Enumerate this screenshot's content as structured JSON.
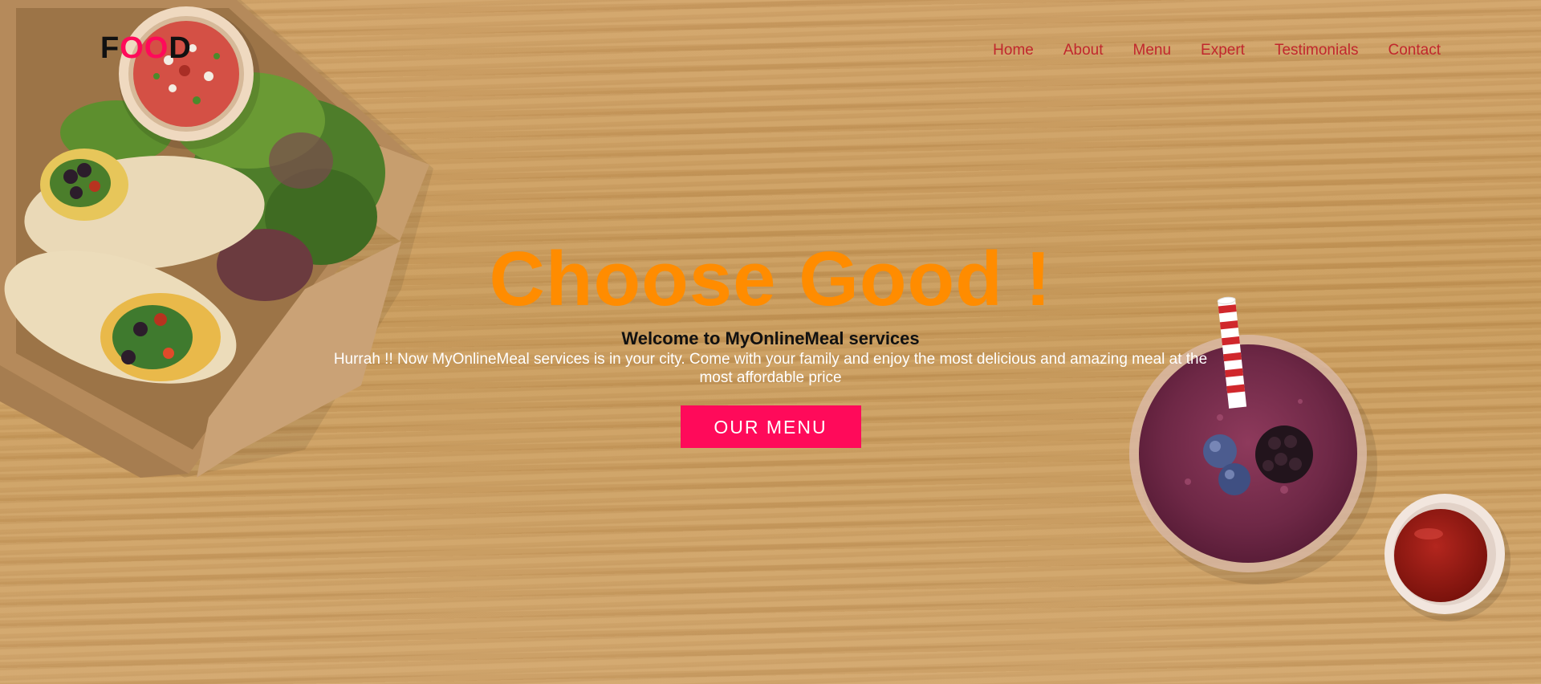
{
  "logo": {
    "prefix": "F",
    "accent": "OO",
    "suffix": "D"
  },
  "nav": {
    "items": [
      {
        "label": "Home"
      },
      {
        "label": "About"
      },
      {
        "label": "Menu"
      },
      {
        "label": "Expert"
      },
      {
        "label": "Testimonials"
      },
      {
        "label": "Contact"
      }
    ]
  },
  "hero": {
    "headline": "Choose Good !",
    "subtitle": "Welcome to MyOnlineMeal services",
    "description": "Hurrah !! Now MyOnlineMeal services is in your city. Come with your family and enjoy the most delicious and amazing meal at the most affordable price",
    "cta_label": "OUR MENU"
  },
  "images": {
    "left": "burrito-salad-box-image",
    "right": "berry-smoothie-image",
    "sauce": "ketchup-cup-image"
  },
  "colors": {
    "accent": "#ff0a5a",
    "headline": "#ff8c00",
    "nav_link": "#c1272d",
    "background": "#c89a5f"
  }
}
